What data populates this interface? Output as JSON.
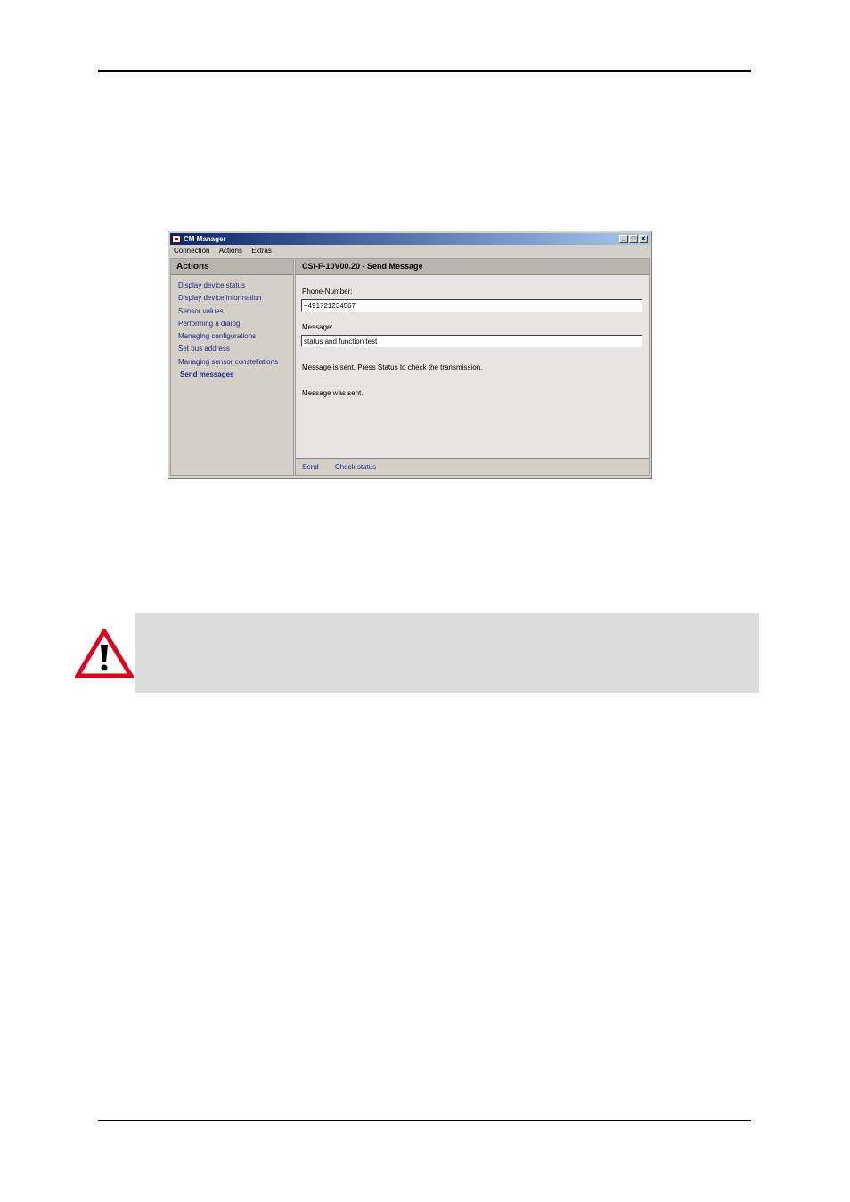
{
  "window": {
    "title": "CM Manager",
    "controls": {
      "minimize": "_",
      "maximize": "□",
      "close": "✕"
    }
  },
  "menu": [
    "Connection",
    "Actions",
    "Extras"
  ],
  "sidebar": {
    "header": "Actions",
    "items": [
      {
        "label": "Display device status",
        "active": false
      },
      {
        "label": "Display device information",
        "active": false
      },
      {
        "label": "Sensor values",
        "active": false
      },
      {
        "label": "Performing a dialog",
        "active": false
      },
      {
        "label": "Managing configurations",
        "active": false
      },
      {
        "label": "Set bus address",
        "active": false
      },
      {
        "label": "Managing sensor constellations",
        "active": false
      },
      {
        "label": "Send messages",
        "active": true
      }
    ]
  },
  "main": {
    "header": "CSI-F-10V00.20 - Send Message",
    "phone_label": "Phone-Number:",
    "phone_value": "+491721234567",
    "message_label": "Message:",
    "message_value": "status and function test",
    "status_sent": "Message is sent. Press Status to check the transmission.",
    "status_result": "Message was sent."
  },
  "bottom_bar": {
    "send": "Send",
    "check_status": "Check status"
  },
  "icons": {
    "warning": "warning-triangle-icon",
    "app": "app-icon"
  },
  "colors": {
    "link": "#1c2a8c",
    "titlebar_start": "#0a246a",
    "warning_red": "#e2001a"
  }
}
